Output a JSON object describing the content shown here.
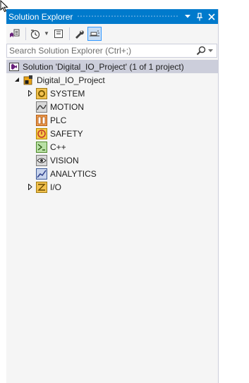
{
  "panel": {
    "title": "Solution Explorer",
    "buttons": {
      "dropdown_icon": "chevron-down-icon",
      "pin_icon": "pin-icon",
      "close_icon": "close-icon"
    }
  },
  "toolbar": {
    "tools": [
      {
        "name": "switch-views-button",
        "icon": "switch-views-icon"
      },
      {
        "name": "pending-changes-filter-button",
        "icon": "clock-filter-icon",
        "has_dropdown": true
      },
      {
        "name": "collapse-all-button",
        "icon": "collapse-all-icon"
      },
      {
        "name": "properties-button",
        "icon": "wrench-icon"
      },
      {
        "name": "preview-selected-items-button",
        "icon": "preview-icon",
        "active": true
      }
    ]
  },
  "search": {
    "placeholder": "Search Solution Explorer (Ctrl+;)"
  },
  "tree": {
    "solution_label": "Solution 'Digital_IO_Project' (1 of 1 project)",
    "project_label": "Digital_IO_Project",
    "items": [
      {
        "label": "SYSTEM",
        "icon": "system-gear-icon",
        "expandable": true
      },
      {
        "label": "MOTION",
        "icon": "motion-icon",
        "expandable": false
      },
      {
        "label": "PLC",
        "icon": "plc-icon",
        "expandable": false
      },
      {
        "label": "SAFETY",
        "icon": "safety-icon",
        "expandable": false
      },
      {
        "label": "C++",
        "icon": "cpp-icon",
        "expandable": false
      },
      {
        "label": "VISION",
        "icon": "vision-eye-icon",
        "expandable": false
      },
      {
        "label": "ANALYTICS",
        "icon": "analytics-icon",
        "expandable": false
      },
      {
        "label": "I/O",
        "icon": "io-icon",
        "expandable": true
      }
    ]
  },
  "colors": {
    "titlebar": "#007acc",
    "panel_bg": "#f5f5f5",
    "selection": "#cccedb"
  }
}
